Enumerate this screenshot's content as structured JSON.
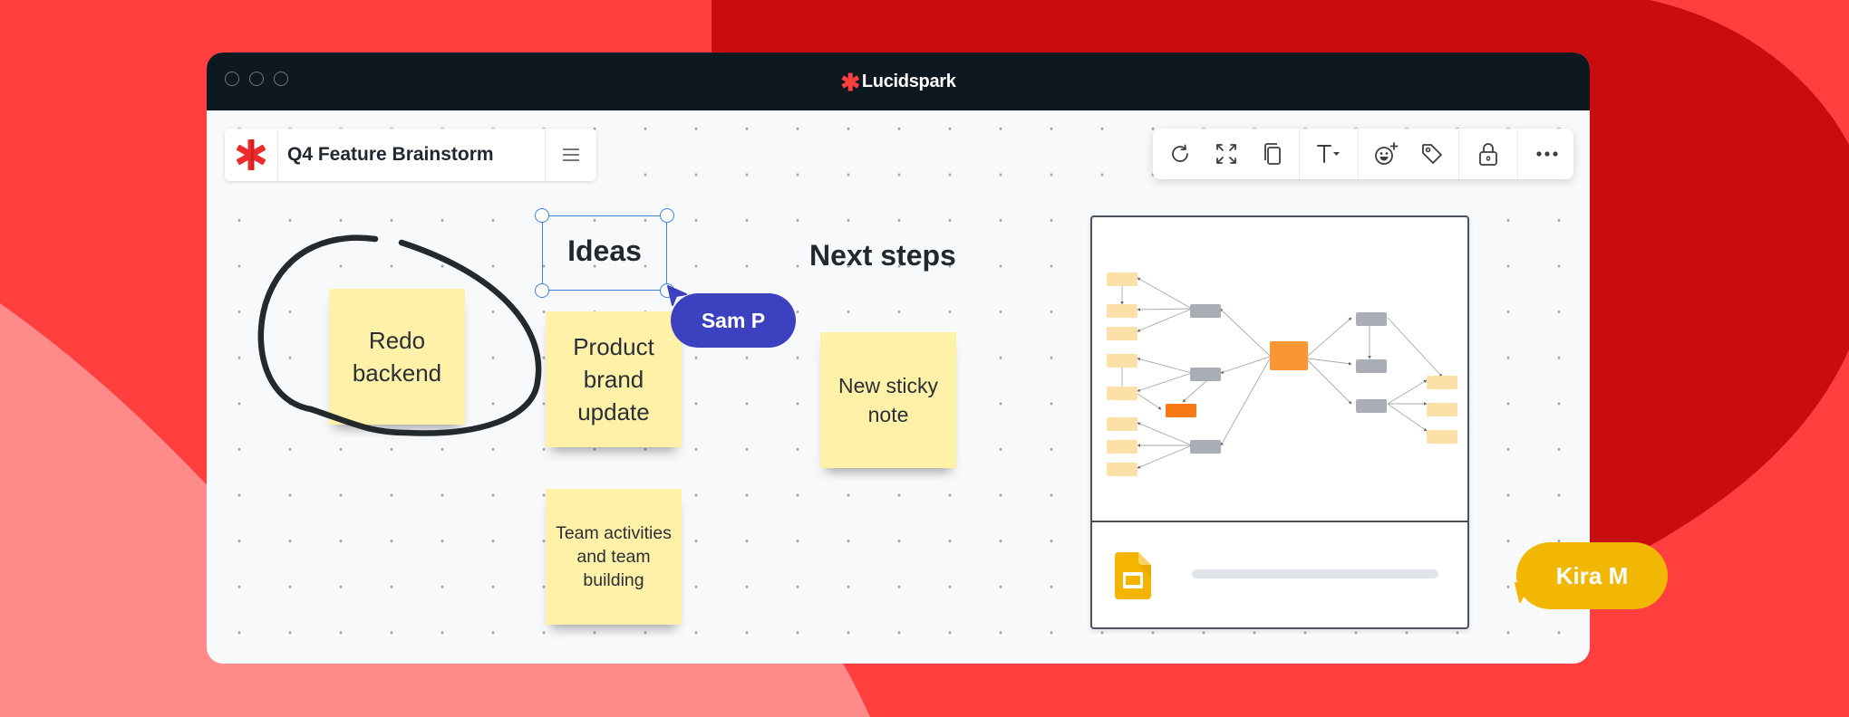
{
  "app": {
    "name": "Lucidspark",
    "brand_color": "#ff3e3e"
  },
  "document": {
    "title": "Q4 Feature Brainstorm"
  },
  "toolbar": {
    "groups": [
      [
        "rotate-icon",
        "fit-to-screen-icon",
        "duplicate-icon"
      ],
      [
        "text-style-icon"
      ],
      [
        "add-reaction-icon",
        "tag-icon"
      ],
      [
        "lock-icon"
      ],
      [
        "more-options-icon"
      ]
    ]
  },
  "board": {
    "headings": {
      "ideas": "Ideas",
      "next_steps": "Next steps"
    },
    "sticky_notes": [
      {
        "id": "redo-backend",
        "text": "Redo backend",
        "lines": [
          "Redo",
          "backend"
        ]
      },
      {
        "id": "product-brand-update",
        "text": "Product brand update",
        "lines": [
          "Product",
          "brand",
          "update"
        ]
      },
      {
        "id": "team-activities",
        "text": "Team activities and team building",
        "lines": [
          "Team activities",
          "and team",
          "building"
        ]
      },
      {
        "id": "new-sticky-note",
        "text": "New sticky note",
        "lines": [
          "New sticky",
          "note"
        ]
      }
    ],
    "sticky_color": "#fff1a8",
    "collaborators": [
      {
        "name": "Sam P",
        "color": "#3c41c0"
      },
      {
        "name": "Kira M",
        "color": "#f2b705"
      }
    ],
    "embed": {
      "type": "Google Slides",
      "icon": "google-slides-icon"
    }
  }
}
